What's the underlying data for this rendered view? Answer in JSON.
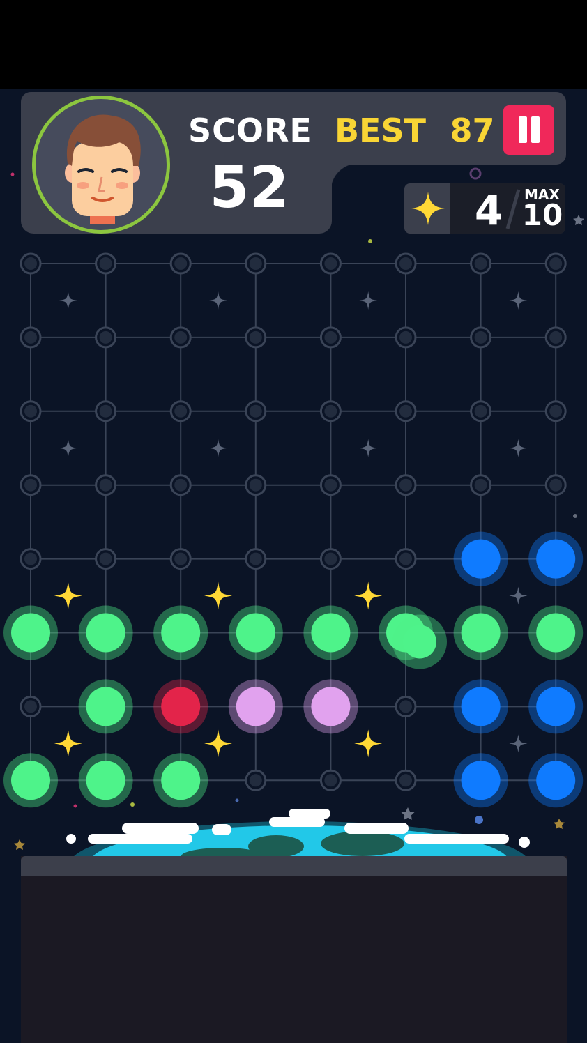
{
  "hud": {
    "score_label": "SCORE",
    "score_value": "52",
    "best_label": "BEST",
    "best_value": "87",
    "pause_icon": "pause-icon",
    "stars_icon": "star-icon",
    "stars_collected": "4",
    "stars_max_label": "MAX",
    "stars_max_value": "10"
  },
  "avatar": {
    "icon": "player-face-icon"
  },
  "colors": {
    "green": "#4ef38a",
    "blue": "#0f7bff",
    "red": "#e3244a",
    "pink": "#e1a2ee",
    "yellow_star": "#ffd836",
    "empty_node": "#222c3e",
    "grid_line": "#3a4457",
    "accent_red": "#f0285a",
    "avatar_ring": "#8cc63f",
    "score_yellow": "#f9d535"
  },
  "board": {
    "columns": 8,
    "rows": 8,
    "cells": [
      [
        "empty",
        "empty",
        "empty",
        "empty",
        "empty",
        "empty",
        "empty",
        "empty"
      ],
      [
        "empty",
        "empty",
        "empty",
        "empty",
        "empty",
        "empty",
        "empty",
        "empty"
      ],
      [
        "empty",
        "empty",
        "empty",
        "empty",
        "empty",
        "empty",
        "empty",
        "empty"
      ],
      [
        "empty",
        "empty",
        "empty",
        "empty",
        "empty",
        "empty",
        "empty",
        "empty"
      ],
      [
        "empty",
        "empty",
        "empty",
        "empty",
        "empty",
        "empty",
        "blue",
        "blue"
      ],
      [
        "green",
        "green",
        "green",
        "green",
        "green",
        "green",
        "green",
        "green"
      ],
      [
        "empty",
        "green",
        "red",
        "pink",
        "pink",
        "empty",
        "blue",
        "blue"
      ],
      [
        "green",
        "green",
        "green",
        "empty",
        "empty",
        "empty",
        "blue",
        "blue"
      ]
    ]
  }
}
